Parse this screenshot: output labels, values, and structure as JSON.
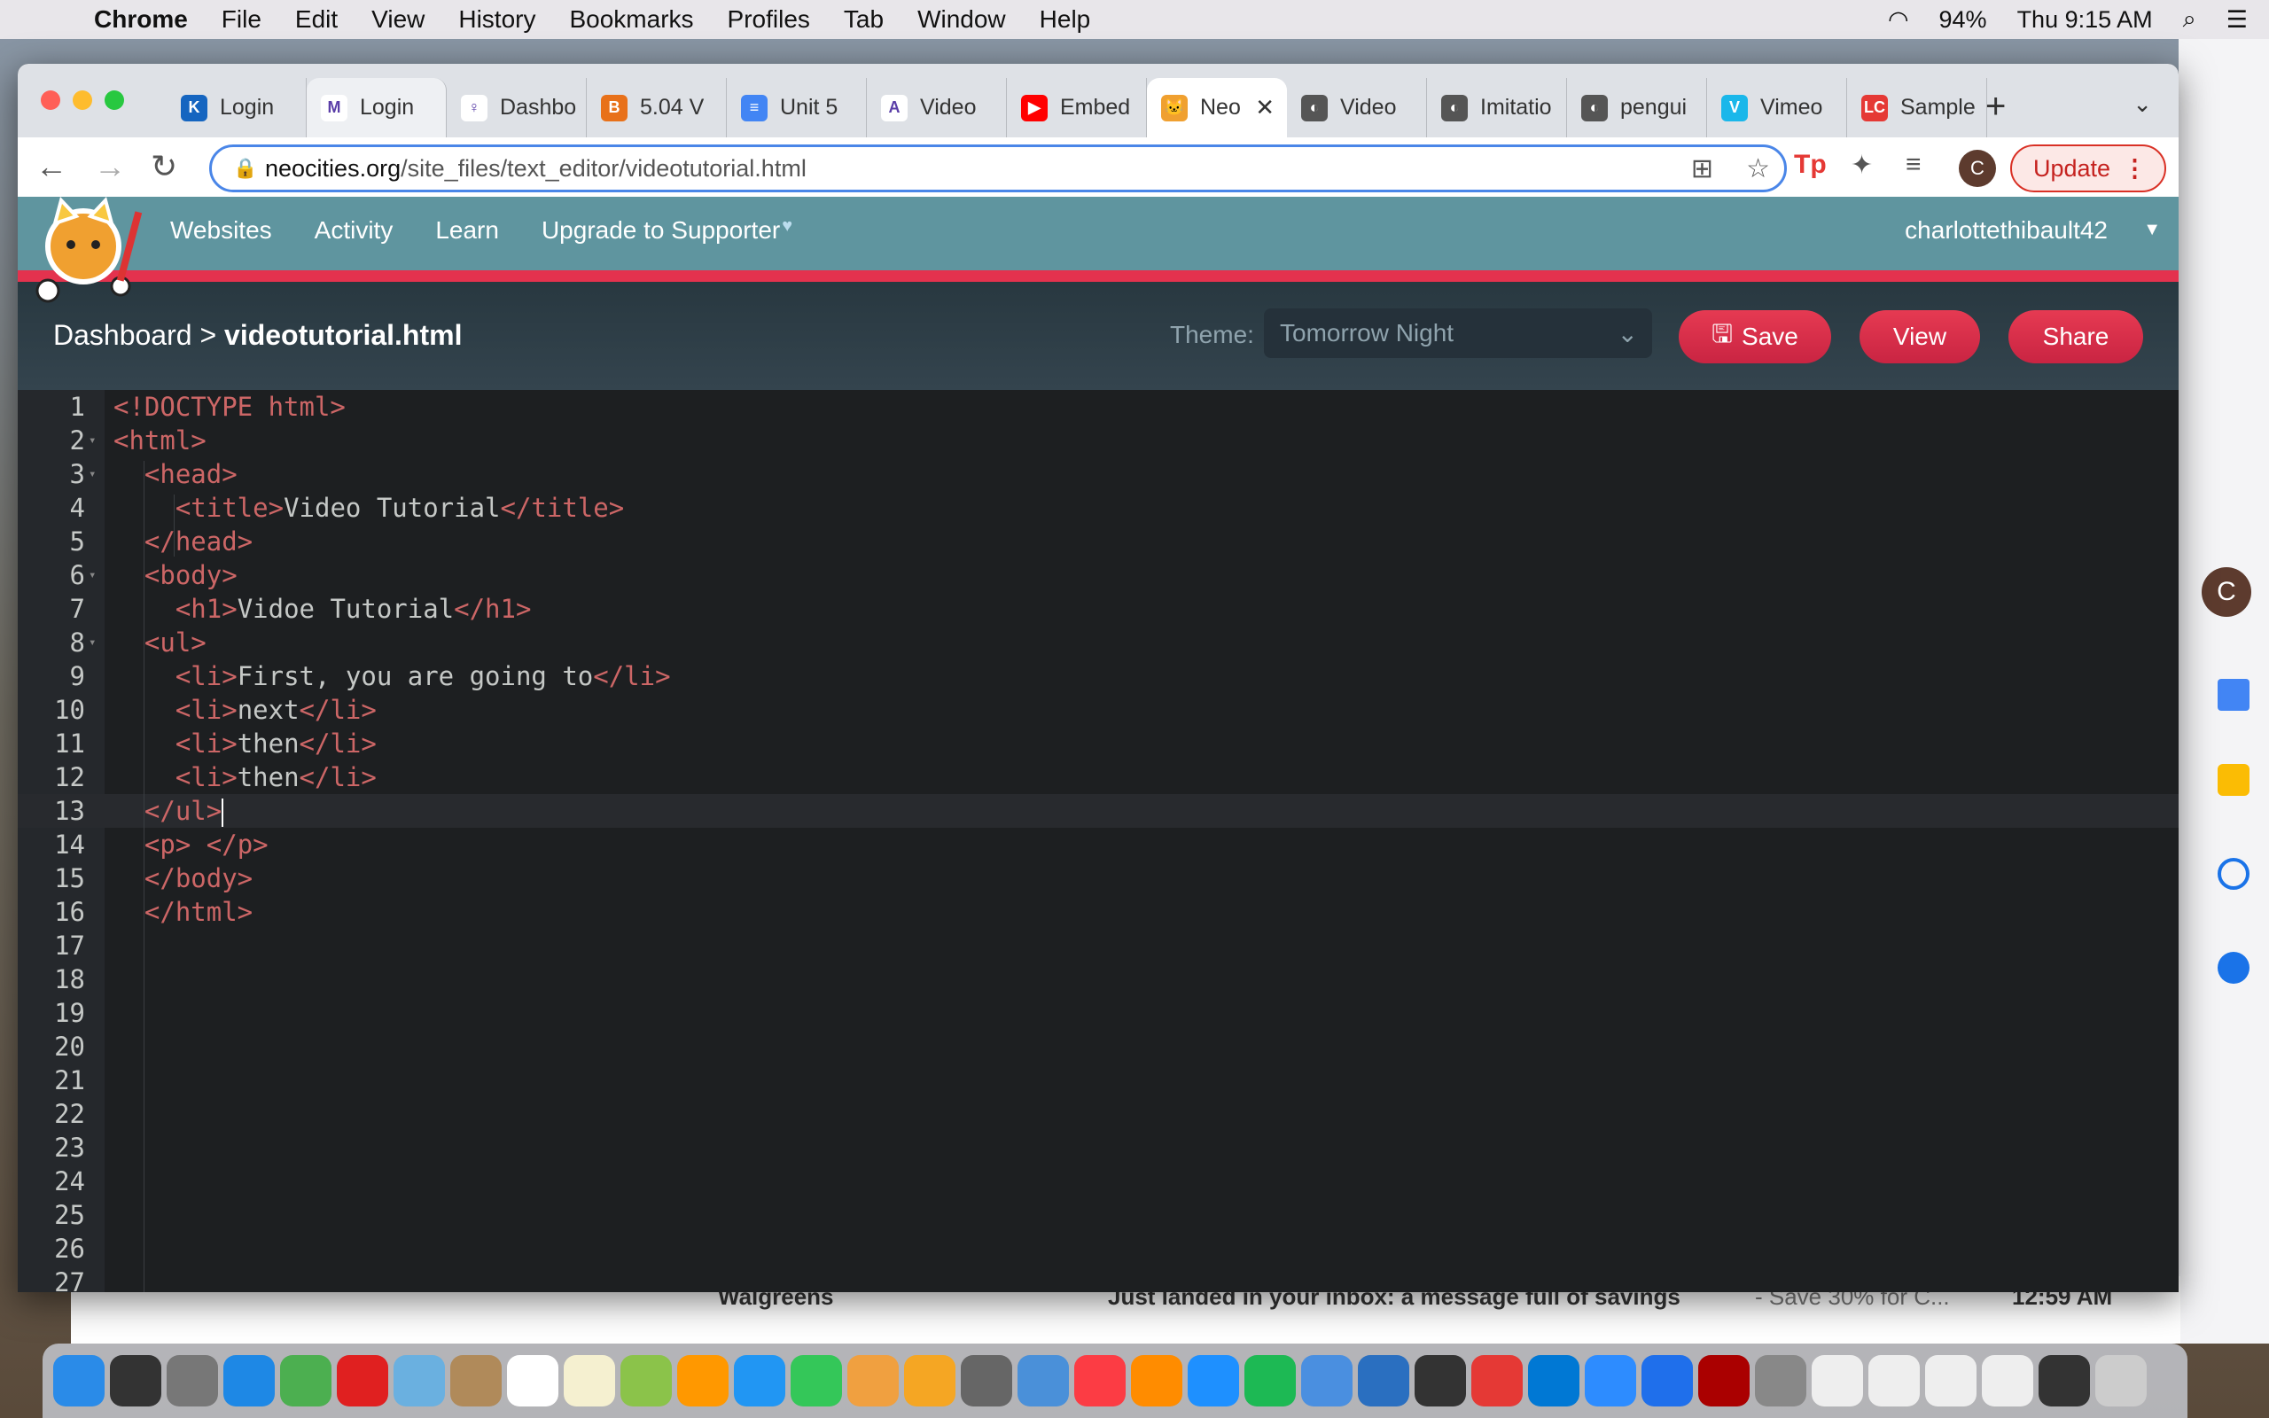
{
  "menubar": {
    "app": "Chrome",
    "items": [
      "File",
      "Edit",
      "View",
      "History",
      "Bookmarks",
      "Profiles",
      "Tab",
      "Window",
      "Help"
    ],
    "battery": "94%",
    "clock": "Thu 9:15 AM"
  },
  "tabs": [
    {
      "label": "Login",
      "color": "#1565c0",
      "glyph": "K"
    },
    {
      "label": "Login",
      "color": "#ffffff",
      "glyph": "M"
    },
    {
      "label": "Dashbo",
      "color": "#ffffff",
      "glyph": "♀"
    },
    {
      "label": "5.04 V",
      "color": "#e8711a",
      "glyph": "B"
    },
    {
      "label": "Unit 5",
      "color": "#4285f4",
      "glyph": "≡"
    },
    {
      "label": "Video",
      "color": "#ffffff",
      "glyph": "A"
    },
    {
      "label": "Embed",
      "color": "#ff0000",
      "glyph": "▶"
    },
    {
      "label": "Neo",
      "color": "#f0a030",
      "glyph": "🐱",
      "active": true
    },
    {
      "label": "Video",
      "color": "#555555",
      "glyph": "◐"
    },
    {
      "label": "Imitatio",
      "color": "#555555",
      "glyph": "◐"
    },
    {
      "label": "pengui",
      "color": "#555555",
      "glyph": "◐"
    },
    {
      "label": "Vimeo",
      "color": "#1ab7ea",
      "glyph": "V"
    },
    {
      "label": "Sample",
      "color": "#e53935",
      "glyph": "LC"
    }
  ],
  "url": {
    "host": "neocities.org",
    "path": "/site_files/text_editor/videotutorial.html"
  },
  "profile_initial": "C",
  "update_label": "Update",
  "site_nav": {
    "links": [
      "Websites",
      "Activity",
      "Learn",
      "Upgrade to Supporter"
    ],
    "heart": "♥",
    "user": "charlottethibault42"
  },
  "header": {
    "dashboard": "Dashboard",
    "sep": ">",
    "file": "videotutorial.html",
    "theme_label": "Theme:",
    "theme_value": "Tomorrow Night",
    "save": "Save",
    "view": "View",
    "share": "Share"
  },
  "code": [
    "<!DOCTYPE html>",
    "<html>",
    "  <head>",
    "    <title>Video Tutorial</title>",
    "  </head>",
    "  <body>",
    "    <h1>Vidoe Tutorial</h1>",
    "  <ul>",
    "    <li>First, you are going to</li>",
    "    <li>next</li>",
    "    <li>then</li>",
    "    <li>then</li>",
    "  </ul>",
    "  <p> </p>",
    "  </body>",
    "  </html>",
    "",
    "",
    "",
    "",
    "",
    "",
    "",
    "",
    "",
    "",
    ""
  ],
  "fold_lines": [
    2,
    3,
    6,
    8
  ],
  "active_line": 13,
  "background_email": {
    "sender": "Walgreens",
    "subject": "Just landed in your inbox: a message full of savings",
    "snippet": "- Save 30% for C...",
    "time": "12:59 AM"
  },
  "side_panel_avatar": "C"
}
